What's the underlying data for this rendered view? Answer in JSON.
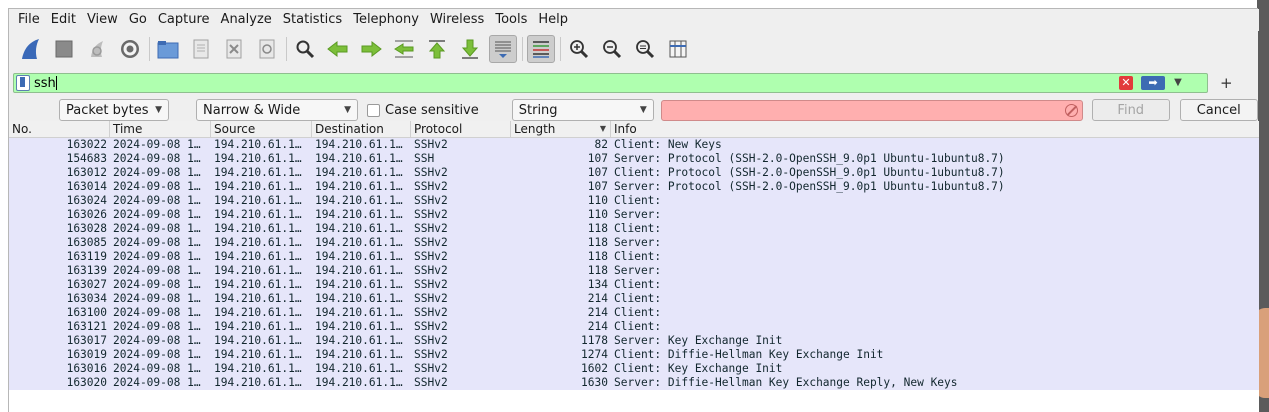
{
  "menu": [
    "File",
    "Edit",
    "View",
    "Go",
    "Capture",
    "Analyze",
    "Statistics",
    "Telephony",
    "Wireless",
    "Tools",
    "Help"
  ],
  "toolbar_icons": [
    "shark-fin-start-icon",
    "stop-icon",
    "restart-icon",
    "capture-options-gear-icon",
    "open-folder-icon",
    "save-file-icon",
    "close-file-icon",
    "reload-icon",
    "find-packet-icon",
    "go-back-icon",
    "go-forward-icon",
    "go-to-packet-icon",
    "first-packet-icon",
    "last-packet-icon",
    "auto-scroll-icon",
    "colorize-icon",
    "zoom-in-icon",
    "zoom-out-icon",
    "normal-size-icon",
    "resize-columns-icon"
  ],
  "filter": {
    "value": "ssh"
  },
  "search": {
    "search_in": "Packet bytes",
    "char_width": "Narrow & Wide",
    "case_label": "Case sensitive",
    "search_type": "String",
    "find_label": "Find",
    "cancel_label": "Cancel"
  },
  "columns": [
    "No.",
    "Time",
    "Source",
    "Destination",
    "Protocol",
    "Length",
    "Info"
  ],
  "rows": [
    {
      "no": "163022",
      "time": "2024-09-08 1…",
      "src": "194.210.61.1…",
      "dst": "194.210.61.1…",
      "proto": "SSHv2",
      "len": "82",
      "info": "Client: New Keys"
    },
    {
      "no": "154683",
      "time": "2024-09-08 1…",
      "src": "194.210.61.1…",
      "dst": "194.210.61.1…",
      "proto": "SSH",
      "len": "107",
      "info": "Server: Protocol (SSH-2.0-OpenSSH_9.0p1 Ubuntu-1ubuntu8.7)"
    },
    {
      "no": "163012",
      "time": "2024-09-08 1…",
      "src": "194.210.61.1…",
      "dst": "194.210.61.1…",
      "proto": "SSHv2",
      "len": "107",
      "info": "Client: Protocol (SSH-2.0-OpenSSH_9.0p1 Ubuntu-1ubuntu8.7)"
    },
    {
      "no": "163014",
      "time": "2024-09-08 1…",
      "src": "194.210.61.1…",
      "dst": "194.210.61.1…",
      "proto": "SSHv2",
      "len": "107",
      "info": "Server: Protocol (SSH-2.0-OpenSSH_9.0p1 Ubuntu-1ubuntu8.7)"
    },
    {
      "no": "163024",
      "time": "2024-09-08 1…",
      "src": "194.210.61.1…",
      "dst": "194.210.61.1…",
      "proto": "SSHv2",
      "len": "110",
      "info": "Client:"
    },
    {
      "no": "163026",
      "time": "2024-09-08 1…",
      "src": "194.210.61.1…",
      "dst": "194.210.61.1…",
      "proto": "SSHv2",
      "len": "110",
      "info": "Server:"
    },
    {
      "no": "163028",
      "time": "2024-09-08 1…",
      "src": "194.210.61.1…",
      "dst": "194.210.61.1…",
      "proto": "SSHv2",
      "len": "118",
      "info": "Client:"
    },
    {
      "no": "163085",
      "time": "2024-09-08 1…",
      "src": "194.210.61.1…",
      "dst": "194.210.61.1…",
      "proto": "SSHv2",
      "len": "118",
      "info": "Server:"
    },
    {
      "no": "163119",
      "time": "2024-09-08 1…",
      "src": "194.210.61.1…",
      "dst": "194.210.61.1…",
      "proto": "SSHv2",
      "len": "118",
      "info": "Client:"
    },
    {
      "no": "163139",
      "time": "2024-09-08 1…",
      "src": "194.210.61.1…",
      "dst": "194.210.61.1…",
      "proto": "SSHv2",
      "len": "118",
      "info": "Server:"
    },
    {
      "no": "163027",
      "time": "2024-09-08 1…",
      "src": "194.210.61.1…",
      "dst": "194.210.61.1…",
      "proto": "SSHv2",
      "len": "134",
      "info": "Client:"
    },
    {
      "no": "163034",
      "time": "2024-09-08 1…",
      "src": "194.210.61.1…",
      "dst": "194.210.61.1…",
      "proto": "SSHv2",
      "len": "214",
      "info": "Client:"
    },
    {
      "no": "163100",
      "time": "2024-09-08 1…",
      "src": "194.210.61.1…",
      "dst": "194.210.61.1…",
      "proto": "SSHv2",
      "len": "214",
      "info": "Client:"
    },
    {
      "no": "163121",
      "time": "2024-09-08 1…",
      "src": "194.210.61.1…",
      "dst": "194.210.61.1…",
      "proto": "SSHv2",
      "len": "214",
      "info": "Client:"
    },
    {
      "no": "163017",
      "time": "2024-09-08 1…",
      "src": "194.210.61.1…",
      "dst": "194.210.61.1…",
      "proto": "SSHv2",
      "len": "1178",
      "info": "Server: Key Exchange Init"
    },
    {
      "no": "163019",
      "time": "2024-09-08 1…",
      "src": "194.210.61.1…",
      "dst": "194.210.61.1…",
      "proto": "SSHv2",
      "len": "1274",
      "info": "Client: Diffie-Hellman Key Exchange Init"
    },
    {
      "no": "163016",
      "time": "2024-09-08 1…",
      "src": "194.210.61.1…",
      "dst": "194.210.61.1…",
      "proto": "SSHv2",
      "len": "1602",
      "info": "Client: Key Exchange Init"
    },
    {
      "no": "163020",
      "time": "2024-09-08 1…",
      "src": "194.210.61.1…",
      "dst": "194.210.61.1…",
      "proto": "SSHv2",
      "len": "1630",
      "info": "Server: Diffie-Hellman Key Exchange Reply, New Keys"
    }
  ],
  "colors": {
    "row_bg": "#e6e6fa",
    "filter_valid": "#afffaf",
    "find_invalid": "#ffafaf",
    "accent": "#3d6bb3"
  }
}
